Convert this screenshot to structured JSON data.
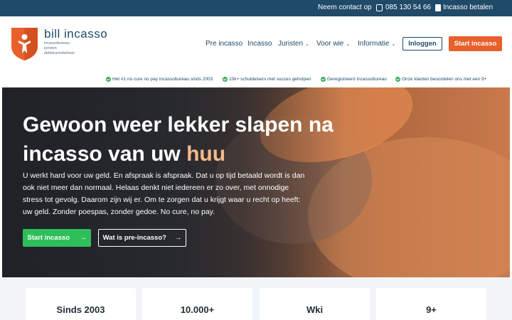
{
  "topbar": {
    "contact": "Neem contact op",
    "phone": "085 130 54 66",
    "pay": "Incasso betalen"
  },
  "header": {
    "brand": "bill incasso",
    "tagline": [
      "incassobureau",
      "juristen",
      "debiteurenbeheer"
    ],
    "nav": [
      "Pre incasso",
      "Incasso",
      "Juristen",
      "Voor wie",
      "Informatie"
    ],
    "login": "Inloggen",
    "start": "Start incasso"
  },
  "usps": [
    "Het #1 no cure no pay incassobureau sinds 2003",
    "10k+ schuldeisers met succes geholpen",
    "Geregistreerd incassobureau",
    "Onze klanten beoordelen ons met een 9+"
  ],
  "hero": {
    "title_main": "Gewoon weer lekker slapen na incasso van uw ",
    "title_highlight": "huu",
    "body": "U werkt hard voor uw geld. En afspraak is afspraak. Dat u op tijd betaald wordt is dan ook niet meer dan normaal. Helaas denkt niet iedereen er zo over, met onnodige stress tot gevolg. Daarom zijn wij er. Om te zorgen dat u krijgt waar u recht op heeft: uw geld. Zonder poespas, zonder gedoe. No cure, no pay.",
    "primary_cta": "Start incasso",
    "secondary_cta": "Wat is pre-incasso?"
  },
  "stats": [
    "Sinds 2003",
    "10.000+",
    "Wki",
    "9+"
  ],
  "colors": {
    "navy": "#1f4a68",
    "orange": "#e8602b",
    "green": "#2fbf5a"
  }
}
